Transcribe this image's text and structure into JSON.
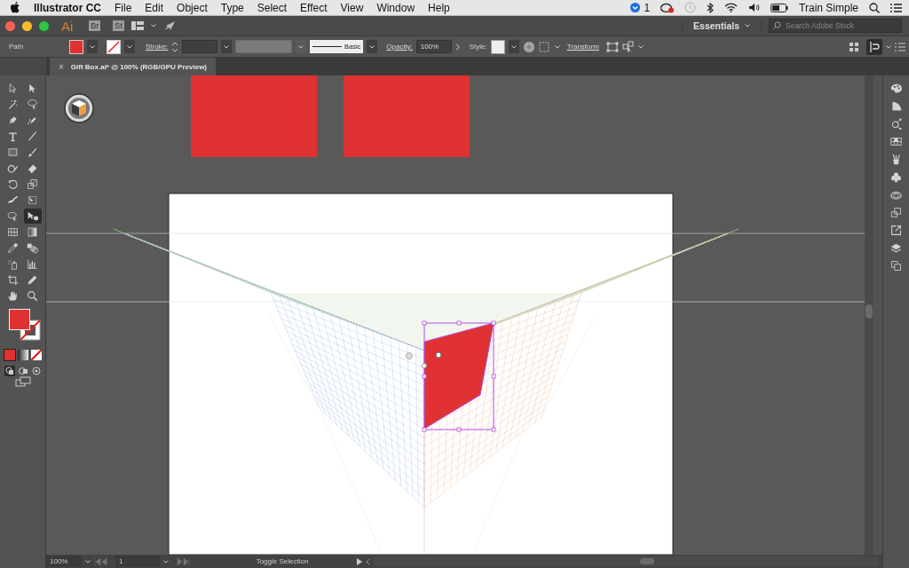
{
  "menubar": {
    "app_name": "Illustrator CC",
    "menus": [
      "File",
      "Edit",
      "Object",
      "Type",
      "Select",
      "Effect",
      "View",
      "Window",
      "Help"
    ],
    "notification_count": "1",
    "user": "Train Simple"
  },
  "app_bar": {
    "logo": "Ai",
    "bridge": "Br",
    "stock": "St",
    "workspace": "Essentials",
    "search": {
      "placeholder": "Search Adobe Stock"
    }
  },
  "control_bar": {
    "selection_type": "Path",
    "stroke_label": "Stroke:",
    "brush": "Basic",
    "opacity_label": "Opacity:",
    "opacity": "100%",
    "style_label": "Style:",
    "transform": "Transform"
  },
  "document_tab": {
    "close": "×",
    "title": "Gift Box.ai* @ 100% (RGB/GPU Preview)"
  },
  "tools": [
    {
      "kind": "selection",
      "selected": false
    },
    {
      "kind": "direct",
      "selected": false
    },
    {
      "kind": "wand",
      "selected": false
    },
    {
      "kind": "lasso",
      "selected": false
    },
    {
      "kind": "pen",
      "selected": false
    },
    {
      "kind": "curvature",
      "selected": false
    },
    {
      "kind": "type",
      "selected": false
    },
    {
      "kind": "line",
      "selected": false
    },
    {
      "kind": "rectangle",
      "selected": false
    },
    {
      "kind": "brush",
      "selected": false
    },
    {
      "kind": "shaper",
      "selected": false
    },
    {
      "kind": "eraser",
      "selected": false
    },
    {
      "kind": "rotate",
      "selected": false
    },
    {
      "kind": "scale",
      "selected": false
    },
    {
      "kind": "puppet",
      "selected": false
    },
    {
      "kind": "freetransform",
      "selected": false
    },
    {
      "kind": "shapebuilder",
      "selected": false
    },
    {
      "kind": "perspective",
      "selected": true
    },
    {
      "kind": "mesh",
      "selected": false
    },
    {
      "kind": "gradient",
      "selected": false
    },
    {
      "kind": "eyedropper",
      "selected": false
    },
    {
      "kind": "blend",
      "selected": false
    },
    {
      "kind": "sprayer",
      "selected": false
    },
    {
      "kind": "graph",
      "selected": false
    },
    {
      "kind": "artboard",
      "selected": false
    },
    {
      "kind": "pencil",
      "selected": false
    },
    {
      "kind": "hand",
      "selected": false
    },
    {
      "kind": "zoom",
      "selected": false
    }
  ],
  "status_bar": {
    "zoom": "100%",
    "artboard": "1",
    "tool_label": "Toggle Selection"
  }
}
